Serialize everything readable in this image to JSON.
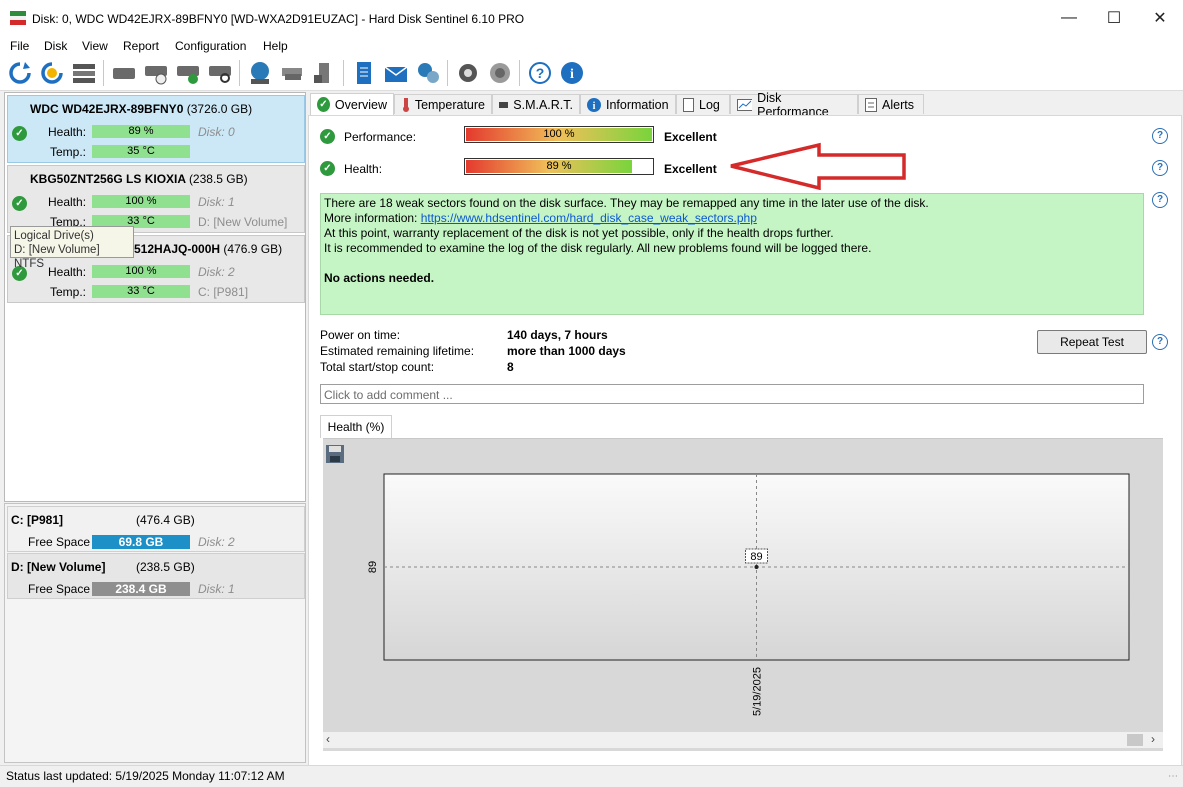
{
  "window": {
    "title": "Disk: 0, WDC WD42EJRX-89BFNY0 [WD-WXA2D91EUZAC]  -  Hard Disk Sentinel 6.10 PRO",
    "minimize_icon": "minimize-icon",
    "maximize_icon": "maximize-icon",
    "close_icon": "close-icon"
  },
  "menu": [
    "File",
    "Disk",
    "View",
    "Report",
    "Configuration",
    "Help"
  ],
  "toolbar_icons": [
    "refresh-icon",
    "refresh-warning-icon",
    "disk-list-icon",
    "disk-icon",
    "disk-clock-icon",
    "disk-check-icon",
    "disk-search-icon",
    "network-icon",
    "disk-stack-icon",
    "usb-disk-icon",
    "report-icon",
    "email-icon",
    "network-share-icon",
    "settings-icon",
    "sound-icon",
    "help-icon",
    "info-icon"
  ],
  "disks": [
    {
      "name": "WDC WD42EJRX-89BFNY0",
      "size": "(3726.0 GB)",
      "health_label": "Health:",
      "health": "89 %",
      "disk_label": "Disk: 0",
      "temp_label": "Temp.:",
      "temp": "35 °C",
      "volume": ""
    },
    {
      "name": "KBG50ZNT256G LS KIOXIA",
      "size": "(238.5 GB)",
      "health_label": "Health:",
      "health": "100 %",
      "disk_label": "Disk: 1",
      "temp_label": "Temp.:",
      "temp": "33 °C",
      "volume": "D: [New Volume]"
    },
    {
      "name": "SAMSUNG MZVL2512HAJQ-000H",
      "size": "(476.9 GB)",
      "health_label": "Health:",
      "health": "100 %",
      "disk_label": "Disk: 2",
      "temp_label": "Temp.:",
      "temp": "33 °C",
      "volume": "C: [P981]"
    }
  ],
  "tooltip": {
    "line1": "Logical Drive(s)",
    "line2": "D: [New Volume] NTFS"
  },
  "volumes": [
    {
      "name": "C: [P981]",
      "size": "(476.4 GB)",
      "free_label": "Free Space",
      "free": "69.8 GB",
      "disk": "Disk: 2",
      "bar_color": "#1e90c8"
    },
    {
      "name": "D: [New Volume]",
      "size": "(238.5 GB)",
      "free_label": "Free Space",
      "free": "238.4 GB",
      "disk": "Disk: 1",
      "bar_color": "#8f8f8f"
    }
  ],
  "tabs": [
    "Overview",
    "Temperature",
    "S.M.A.R.T.",
    "Information",
    "Log",
    "Disk Performance",
    "Alerts"
  ],
  "overview": {
    "performance_label": "Performance:",
    "performance_value": "100 %",
    "performance_fraction": 1.0,
    "performance_rating": "Excellent",
    "health_label": "Health:",
    "health_value": "89 %",
    "health_fraction": 0.89,
    "health_rating": "Excellent",
    "info_line1": "There are 18 weak sectors found on the disk surface. They may be remapped any time in the later use of the disk.",
    "info_more_label": "More information: ",
    "info_link": "https://www.hdsentinel.com/hard_disk_case_weak_sectors.php",
    "info_line3": "At this point, warranty replacement of the disk is not yet possible, only if the health drops further.",
    "info_line4": "It is recommended to examine the log of the disk regularly. All new problems found will be logged there.",
    "info_action": "No actions needed.",
    "power_on_label": "Power on time:",
    "power_on_value": "140 days, 7 hours",
    "lifetime_label": "Estimated remaining lifetime:",
    "lifetime_value": "more than 1000 days",
    "startstop_label": "Total start/stop count:",
    "startstop_value": "8",
    "repeat_test": "Repeat Test",
    "comment_placeholder": "Click to add comment ..."
  },
  "chart_data": {
    "type": "line",
    "title": "Health (%)",
    "x": [
      "5/19/2025"
    ],
    "series": [
      {
        "values": [
          89
        ]
      }
    ],
    "ytick": "89",
    "data_label": "89"
  },
  "status": "Status last updated: 5/19/2025 Monday 11:07:12 AM"
}
